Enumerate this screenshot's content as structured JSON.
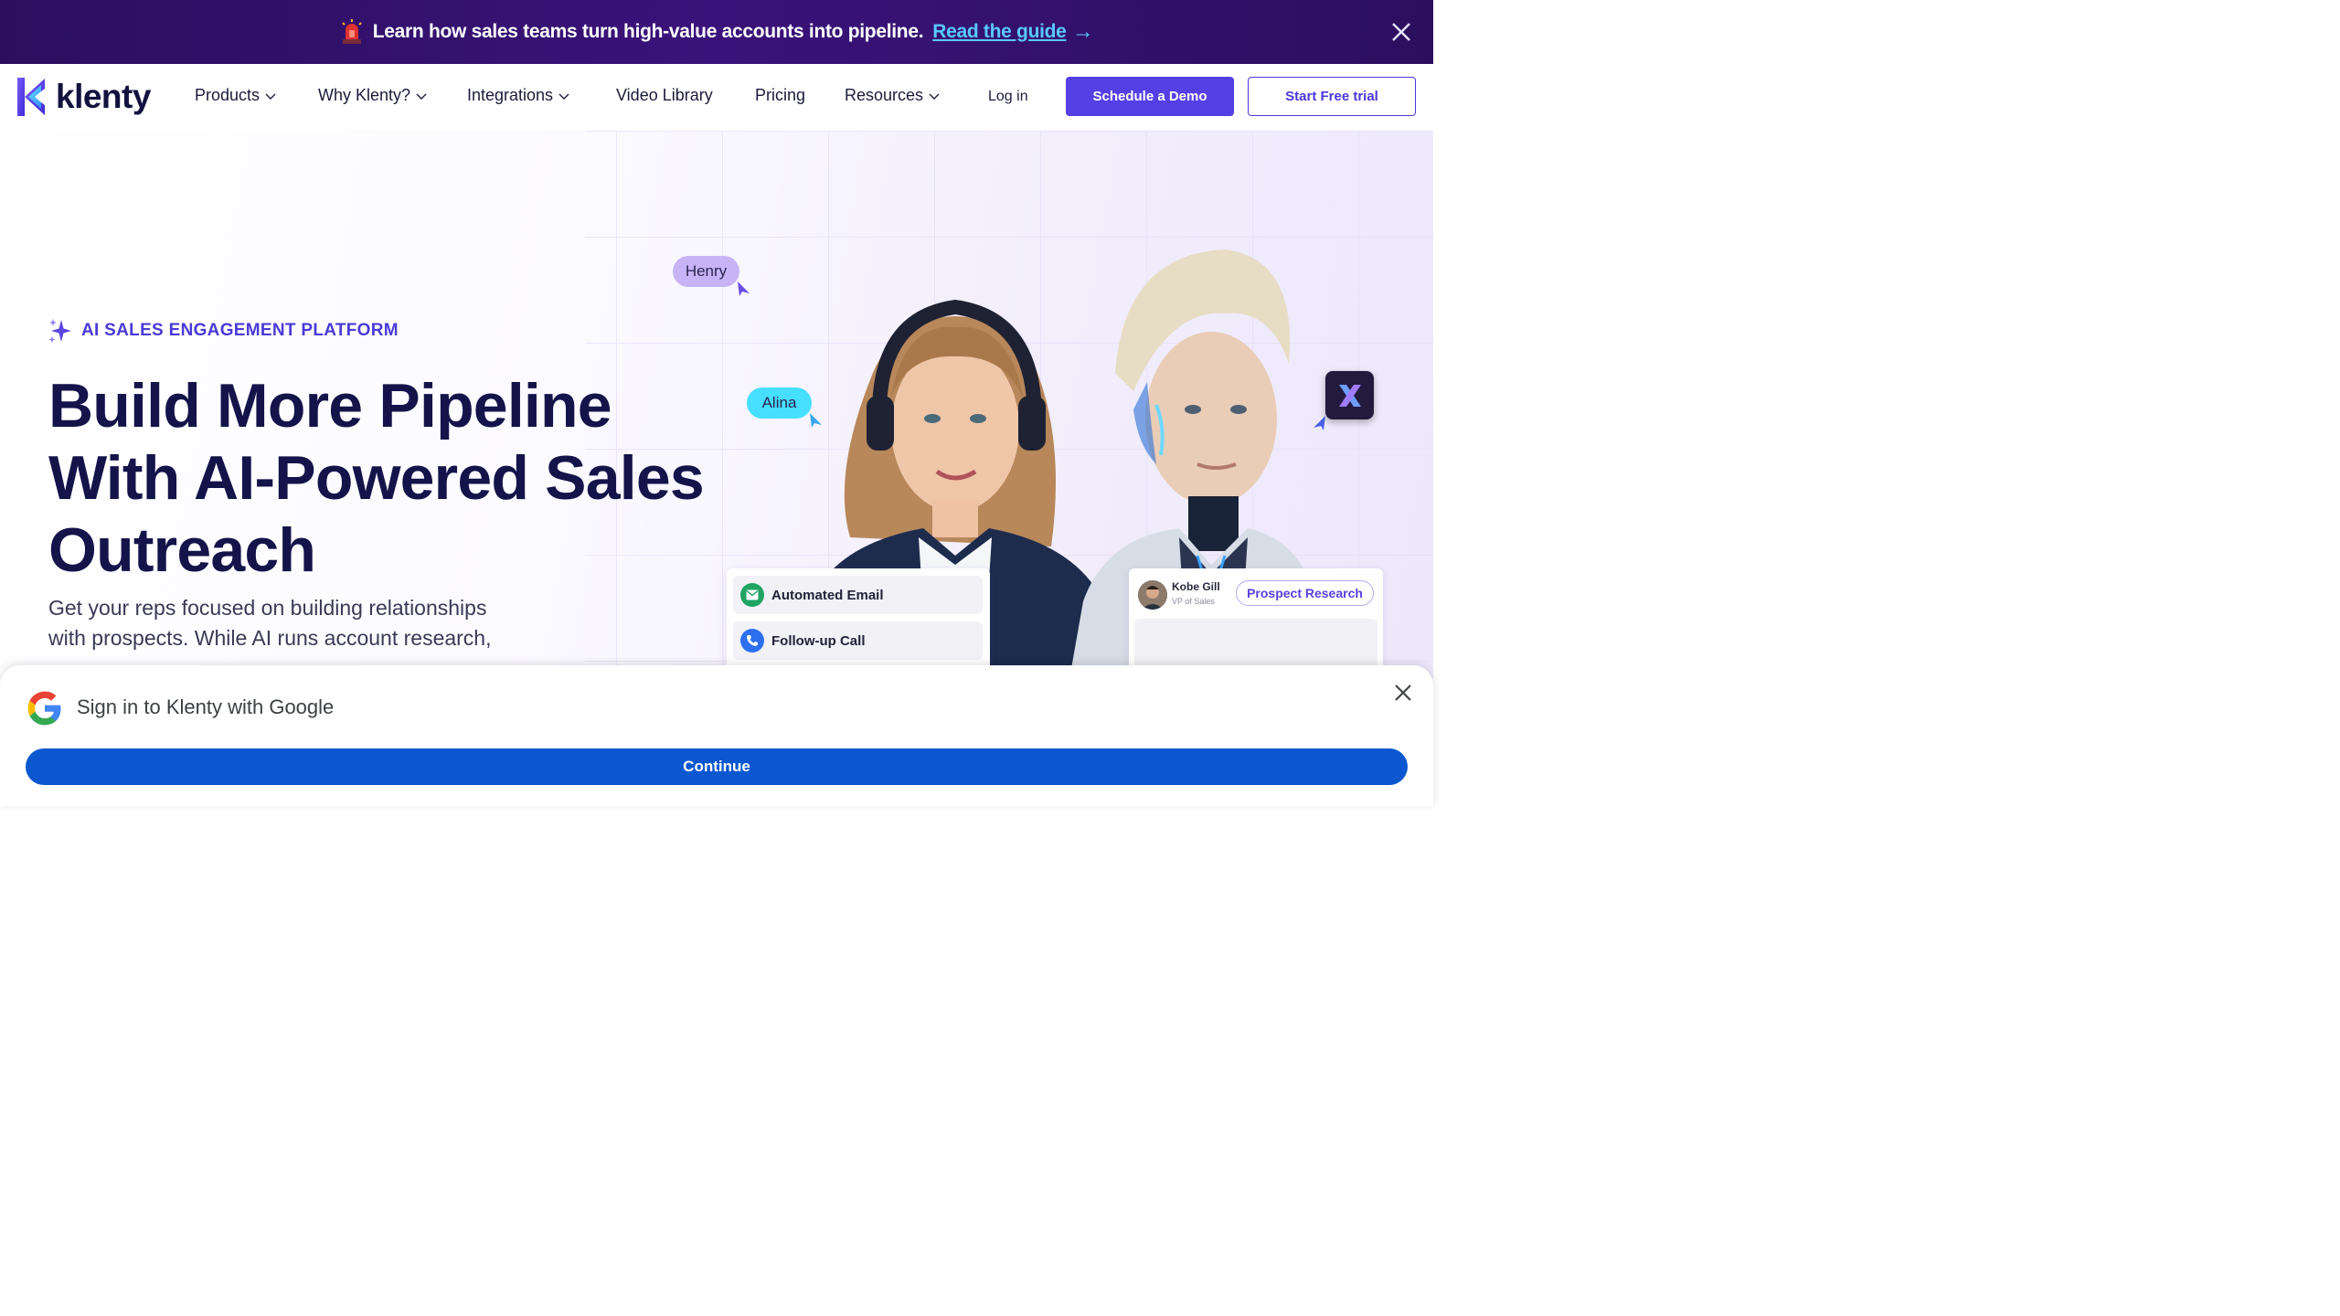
{
  "banner": {
    "text": "Learn how sales teams turn high-value accounts into pipeline.",
    "link_label": "Read the guide",
    "arrow": "→",
    "icon": "siren-icon"
  },
  "nav": {
    "brand": "klenty",
    "items": [
      {
        "label": "Products",
        "has_dropdown": true
      },
      {
        "label": "Why Klenty?",
        "has_dropdown": true
      },
      {
        "label": "Integrations",
        "has_dropdown": true
      },
      {
        "label": "Video Library",
        "has_dropdown": false
      },
      {
        "label": "Pricing",
        "has_dropdown": false
      },
      {
        "label": "Resources",
        "has_dropdown": true
      }
    ],
    "login_label": "Log in",
    "demo_label": "Schedule a Demo",
    "trial_label": "Start Free trial"
  },
  "hero": {
    "eyebrow": "AI SALES ENGAGEMENT PLATFORM",
    "headline_lines": [
      "Build More Pipeline",
      "With AI-Powered Sales",
      "Outreach"
    ],
    "subtext_lines": [
      "Get your reps focused on building relationships",
      "with prospects. While AI runs account research,"
    ],
    "chips": {
      "henry": "Henry",
      "alina": "Alina"
    },
    "card_left": {
      "rows": [
        {
          "label": "Automated Email",
          "icon": "email-icon"
        },
        {
          "label": "Follow-up Call",
          "icon": "phone-icon"
        }
      ]
    },
    "card_right": {
      "name": "Kobe Gill",
      "title": "VP of Sales",
      "pill": "Prospect Research"
    }
  },
  "google_prompt": {
    "title": "Sign in to Klenty with Google",
    "continue_label": "Continue"
  },
  "colors": {
    "banner_bg": "#2b0f5e",
    "link": "#58c9ff",
    "brand_purple": "#5540e6",
    "headline": "#14134a",
    "google_blue": "#0b57d0"
  }
}
